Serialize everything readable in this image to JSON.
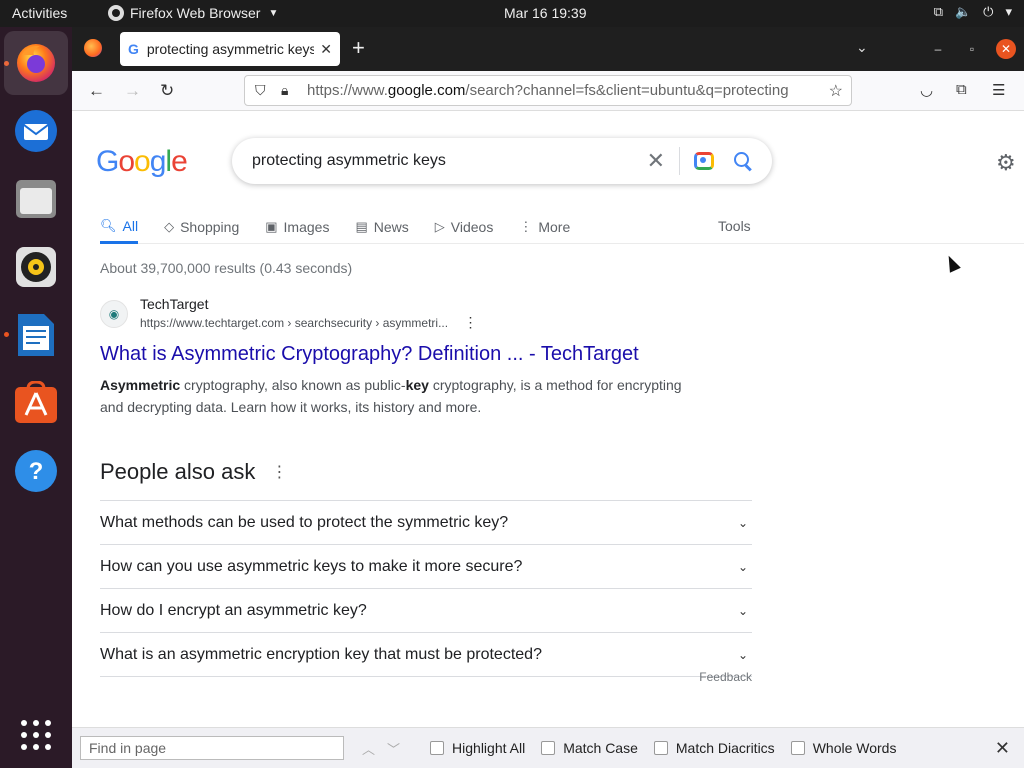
{
  "topbar": {
    "activities": "Activities",
    "app_name": "Firefox Web Browser",
    "clock": "Mar 16  19:39"
  },
  "dock": {
    "items": [
      "firefox",
      "thunderbird",
      "files",
      "rhythmbox",
      "libreoffice-writer",
      "app-center",
      "help",
      "show-apps"
    ]
  },
  "browser": {
    "tab_title": "protecting asymmetric keys",
    "url_prefix": "https://www.",
    "url_domain": "google.com",
    "url_rest": "/search?channel=fs&client=ubuntu&q=protecting"
  },
  "google": {
    "logo": "Google",
    "query": "protecting asymmetric keys",
    "tabs": [
      "All",
      "Shopping",
      "Images",
      "News",
      "Videos",
      "More"
    ],
    "tools": "Tools",
    "stats": "About 39,700,000 results (0.43 seconds)",
    "result": {
      "site_name": "TechTarget",
      "cite": "https://www.techtarget.com › searchsecurity › asymmetri...",
      "title": "What is Asymmetric Cryptography? Definition ... - TechTarget",
      "snippet_b1": "Asymmetric",
      "snippet_t1": " cryptography, also known as public-",
      "snippet_b2": "key",
      "snippet_t2": " cryptography, is a method for encrypting and decrypting data. Learn how it works, its history and more."
    },
    "paa": {
      "heading": "People also ask",
      "questions": [
        "What methods can be used to protect the symmetric key?",
        "How can you use asymmetric keys to make it more secure?",
        "How do I encrypt an asymmetric key?",
        "What is an asymmetric encryption key that must be protected?"
      ],
      "feedback": "Feedback"
    }
  },
  "findbar": {
    "placeholder": "Find in page",
    "options": [
      "Highlight All",
      "Match Case",
      "Match Diacritics",
      "Whole Words"
    ]
  },
  "colors": {
    "link": "#1a0dab",
    "accent": "#1a73e8",
    "ubuntu_orange": "#e95420"
  }
}
